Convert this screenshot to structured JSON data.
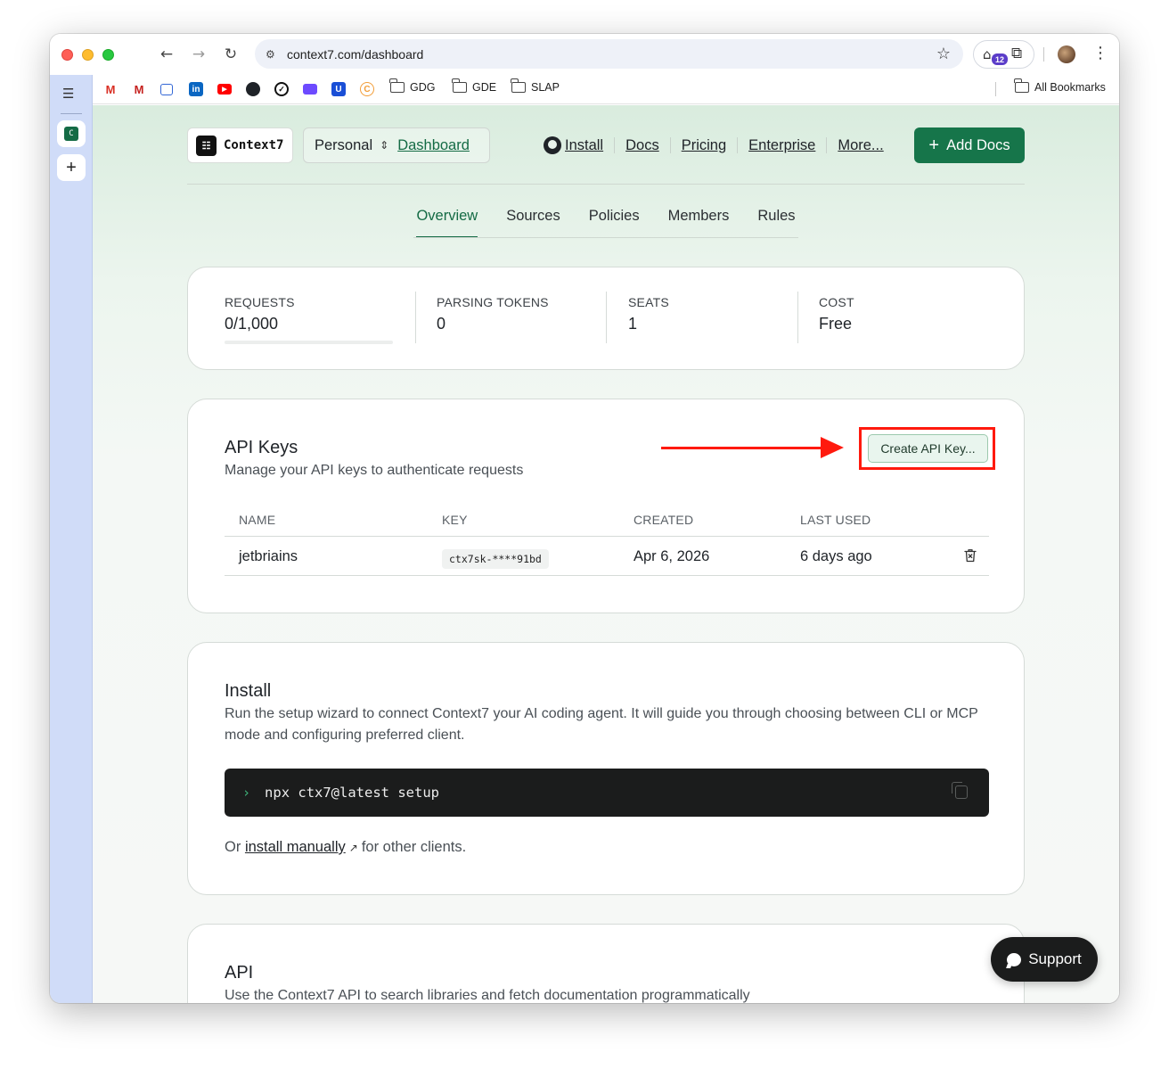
{
  "browser": {
    "url": "context7.com/dashboard",
    "extension_badge": "12",
    "bookmarks": [
      {
        "icon": "gmail-icon",
        "label": ""
      },
      {
        "icon": "gmail-icon",
        "label": ""
      },
      {
        "icon": "mail-icon",
        "label": ""
      },
      {
        "icon": "linkedin-icon",
        "label": ""
      },
      {
        "icon": "youtube-icon",
        "label": ""
      },
      {
        "icon": "github-icon",
        "label": ""
      },
      {
        "icon": "check-circle-icon",
        "label": ""
      },
      {
        "icon": "proton-mail-icon",
        "label": ""
      },
      {
        "icon": "u-app-icon",
        "label": ""
      },
      {
        "icon": "c-app-icon",
        "label": ""
      }
    ],
    "bookmark_folders": [
      "GDG",
      "GDE",
      "SLAP"
    ],
    "all_bookmarks": "All Bookmarks"
  },
  "header": {
    "brand": "Context7",
    "workspace": "Personal",
    "dashboard_link": "Dashboard",
    "nav": [
      "Install",
      "Docs",
      "Pricing",
      "Enterprise",
      "More..."
    ],
    "add_docs": "Add Docs"
  },
  "tabs": [
    "Overview",
    "Sources",
    "Policies",
    "Members",
    "Rules"
  ],
  "active_tab": "Overview",
  "stats": [
    {
      "label": "REQUESTS",
      "value": "0/1,000",
      "progress": 0
    },
    {
      "label": "PARSING TOKENS",
      "value": "0"
    },
    {
      "label": "SEATS",
      "value": "1"
    },
    {
      "label": "COST",
      "value": "Free"
    }
  ],
  "api_keys": {
    "title": "API Keys",
    "subtitle": "Manage your API keys to authenticate requests",
    "create_button": "Create API Key...",
    "columns": [
      "NAME",
      "KEY",
      "CREATED",
      "LAST USED"
    ],
    "rows": [
      {
        "name": "jetbriains",
        "key": "ctx7sk-****91bd",
        "created": "Apr 6, 2026",
        "last_used": "6 days ago"
      }
    ]
  },
  "install": {
    "title": "Install",
    "description": "Run the setup wizard to connect Context7 your AI coding agent. It will guide you through choosing between CLI or MCP mode and configuring preferred client.",
    "command": "npx ctx7@latest setup",
    "or_prefix": "Or",
    "manual_link": "install manually",
    "or_suffix": "for other clients."
  },
  "api": {
    "title": "API",
    "description": "Use the Context7 API to search libraries and fetch documentation programmatically"
  },
  "support": "Support",
  "colors": {
    "brand_green": "#16754a",
    "highlight_red": "#ff1a0e",
    "sidebar": "#d0dcf8"
  }
}
